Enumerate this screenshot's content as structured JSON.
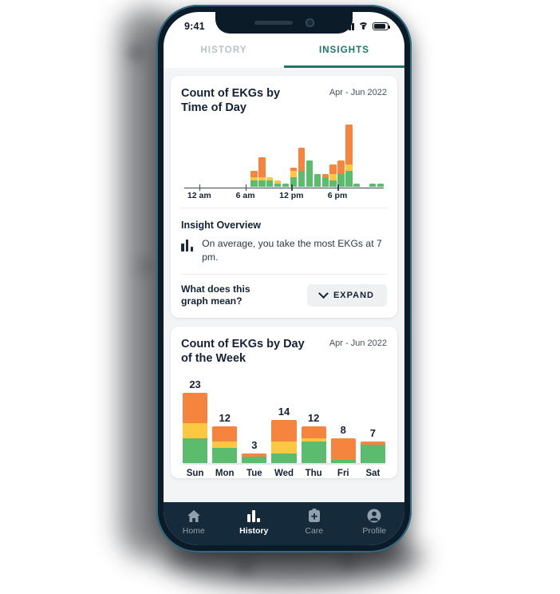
{
  "status_bar": {
    "time": "9:41",
    "icons": [
      "cellular-signal-icon",
      "wifi-icon",
      "battery-icon"
    ]
  },
  "tabs": [
    {
      "label": "HISTORY",
      "active": false
    },
    {
      "label": "INSIGHTS",
      "active": true
    }
  ],
  "accent_color": "#16796a",
  "series_colors": {
    "green": "#5cbc6e",
    "yellow": "#fdc741",
    "orange": "#f5843f"
  },
  "cards": [
    {
      "title": "Count of EKGs by Time of Day",
      "date_range": "Apr - Jun 2022",
      "insight_section_title": "Insight Overview",
      "insight_icon": "bar-chart-icon",
      "insight_text": "On average, you take the most EKGs at 7 pm.",
      "expand_question": "What does this graph mean?",
      "expand_button_label": "EXPAND",
      "expand_button_icon": "chevron-down-icon"
    },
    {
      "title": "Count of EKGs by Day of the Week",
      "date_range": "Apr - Jun 2022"
    }
  ],
  "bottom_nav": [
    {
      "label": "Home",
      "icon": "home-icon",
      "active": false
    },
    {
      "label": "History",
      "icon": "bar-chart-icon",
      "active": true
    },
    {
      "label": "Care",
      "icon": "clipboard-plus-icon",
      "active": false
    },
    {
      "label": "Profile",
      "icon": "person-icon",
      "active": false
    }
  ],
  "chart_data": [
    {
      "type": "bar",
      "stacked": true,
      "title": "Count of EKGs by Time of Day",
      "subtitle": "Apr - Jun 2022",
      "xlabel": "",
      "ylabel": "",
      "grid": false,
      "legend": "none",
      "axis_ticks": [
        {
          "label": "12 am",
          "hour": 0
        },
        {
          "label": "6 am",
          "hour": 6
        },
        {
          "label": "12 pm",
          "hour": 12
        },
        {
          "label": "6 pm",
          "hour": 18
        }
      ],
      "categories": [
        "12 am",
        "1 am",
        "2 am",
        "3 am",
        "4 am",
        "5 am",
        "6 am",
        "7 am",
        "8 am",
        "9 am",
        "10 am",
        "11 am",
        "12 pm",
        "1 pm",
        "2 pm",
        "3 pm",
        "4 pm",
        "5 pm",
        "6 pm",
        "7 pm",
        "8 pm",
        "9 pm",
        "10 pm",
        "11 pm"
      ],
      "series": [
        {
          "name": "green",
          "values": [
            0,
            0,
            0,
            0,
            0,
            0,
            0,
            2,
            2,
            2,
            1,
            1,
            3,
            5,
            8,
            4,
            3,
            2,
            4,
            5,
            1,
            0,
            1,
            1
          ]
        },
        {
          "name": "yellow",
          "values": [
            0,
            0,
            0,
            0,
            0,
            0,
            0,
            1,
            1,
            1,
            1,
            0,
            2,
            0,
            0,
            0,
            0,
            2,
            0,
            2,
            0,
            0,
            0,
            0
          ]
        },
        {
          "name": "orange",
          "values": [
            0,
            0,
            0,
            0,
            0,
            0,
            0,
            2,
            6,
            0,
            0,
            0,
            1,
            7,
            0,
            0,
            1,
            3,
            4,
            12,
            0,
            0,
            0,
            0
          ]
        }
      ],
      "ylim": [
        0,
        19
      ]
    },
    {
      "type": "bar",
      "stacked": true,
      "title": "Count of EKGs by Day of the Week",
      "subtitle": "Apr - Jun 2022",
      "xlabel": "",
      "ylabel": "",
      "grid": false,
      "legend": "none",
      "categories": [
        "Sun",
        "Mon",
        "Tue",
        "Wed",
        "Thu",
        "Fri",
        "Sat"
      ],
      "totals": [
        23,
        12,
        3,
        14,
        12,
        8,
        7
      ],
      "series": [
        {
          "name": "green",
          "values": [
            8,
            5,
            2,
            3,
            7,
            1,
            6
          ]
        },
        {
          "name": "yellow",
          "values": [
            5,
            2,
            0,
            4,
            1,
            0,
            0
          ]
        },
        {
          "name": "orange",
          "values": [
            10,
            5,
            1,
            7,
            4,
            7,
            1
          ]
        }
      ],
      "ylim": [
        0,
        23
      ]
    }
  ]
}
